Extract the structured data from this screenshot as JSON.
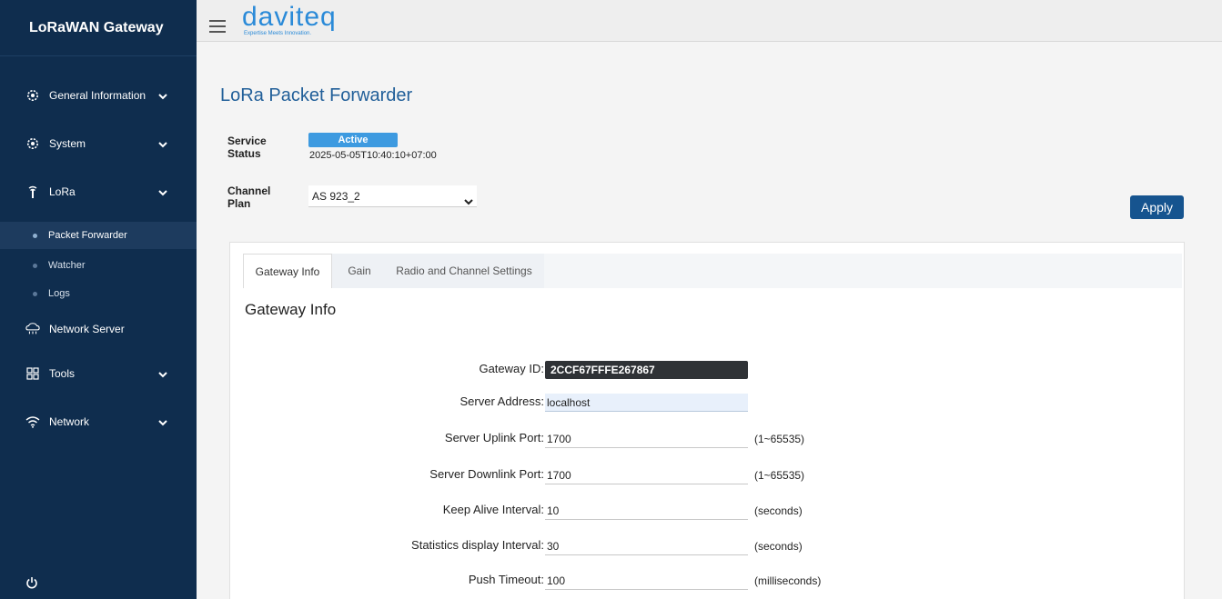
{
  "app": {
    "title": "LoRaWAN Gateway"
  },
  "logo": {
    "text": "daviteq",
    "tagline": "Expertise Meets Innovation."
  },
  "sidebar": {
    "items": [
      {
        "label": "General Information",
        "icon": "gear-icon"
      },
      {
        "label": "System",
        "icon": "gear-icon"
      },
      {
        "label": "LoRa",
        "icon": "antenna-icon"
      },
      {
        "label": "Network Server",
        "icon": "cloud-server-icon"
      },
      {
        "label": "Tools",
        "icon": "grid-icon"
      },
      {
        "label": "Network",
        "icon": "wifi-icon"
      }
    ],
    "lora_sub": [
      {
        "label": "Packet Forwarder",
        "active": true
      },
      {
        "label": "Watcher",
        "active": false
      },
      {
        "label": "Logs",
        "active": false
      }
    ]
  },
  "page": {
    "title": "LoRa Packet Forwarder",
    "service_label_1": "Service",
    "service_label_2": "Status",
    "status_badge": "Active",
    "status_time": "2025-05-05T10:40:10+07:00",
    "channel_label_1": "Channel",
    "channel_label_2": "Plan",
    "channel_plan": "AS 923_2",
    "apply": "Apply"
  },
  "tabs": [
    {
      "label": "Gateway Info",
      "active": true
    },
    {
      "label": "Gain",
      "active": false
    },
    {
      "label": "Radio and Channel Settings",
      "active": false
    }
  ],
  "gateway_info": {
    "section_title": "Gateway Info",
    "rows": [
      {
        "label": "Gateway ID:",
        "value": "2CCF67FFFE267867",
        "unit": ""
      },
      {
        "label": "Server Address:",
        "value": "localhost",
        "unit": ""
      },
      {
        "label": "Server Uplink Port:",
        "value": "1700",
        "unit": "(1~65535)"
      },
      {
        "label": "Server Downlink Port:",
        "value": "1700",
        "unit": "(1~65535)"
      },
      {
        "label": "Keep Alive Interval:",
        "value": "10",
        "unit": "(seconds)"
      },
      {
        "label": "Statistics display Interval:",
        "value": "30",
        "unit": "(seconds)"
      },
      {
        "label": "Push Timeout:",
        "value": "100",
        "unit": "(milliseconds)"
      }
    ]
  },
  "colors": {
    "sidebar": "#0f2d4e",
    "accent": "#215f99",
    "badge": "#3d9ae0",
    "apply": "#16548f"
  }
}
